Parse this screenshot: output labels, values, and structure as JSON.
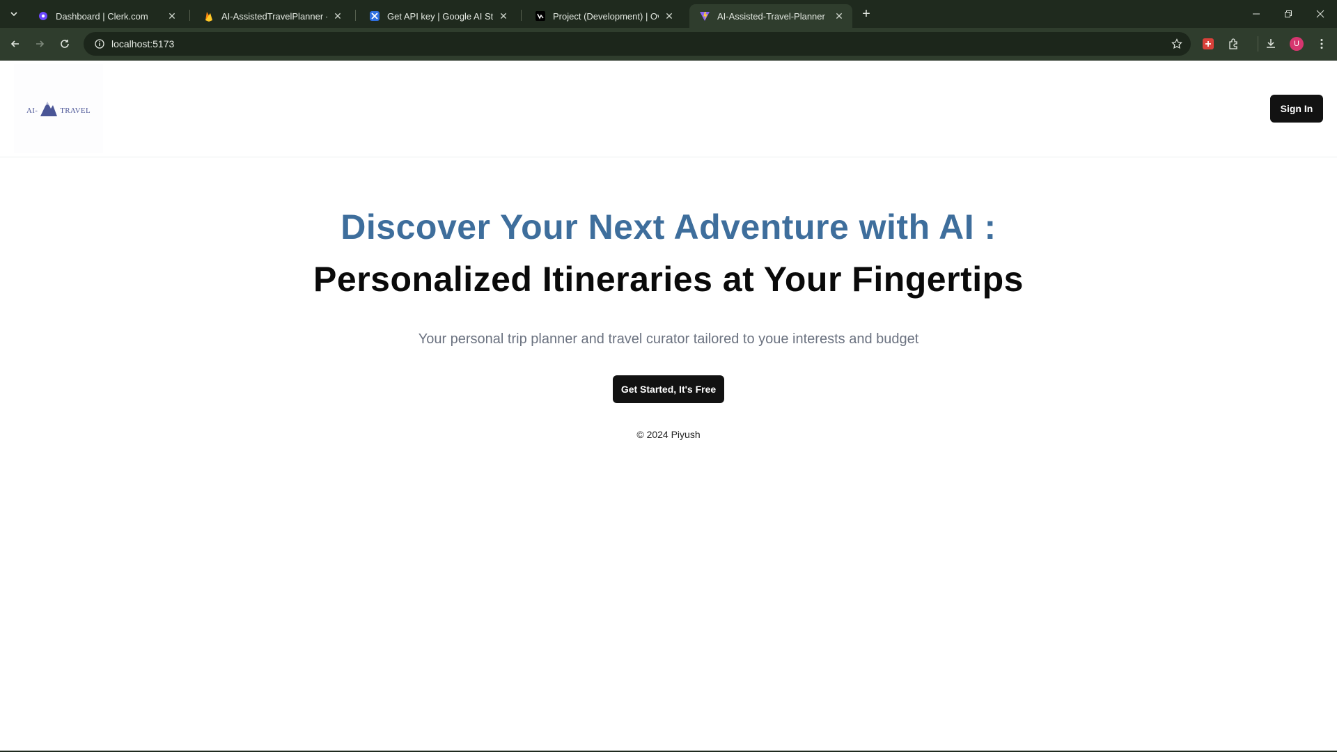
{
  "browser": {
    "tabs": [
      {
        "title": "Dashboard | Clerk.com",
        "favicon": "clerk-icon"
      },
      {
        "title": "AI-AssistedTravelPlanner - Clou",
        "favicon": "firebase-icon"
      },
      {
        "title": "Get API key | Google AI Studio",
        "favicon": "ai-studio-icon"
      },
      {
        "title": "Project (Development) | Overvi",
        "favicon": "vercel-icon"
      },
      {
        "title": "AI-Assisted-Travel-Planner",
        "favicon": "vite-icon"
      }
    ],
    "address": "localhost:5173",
    "profile_initial": "U"
  },
  "header": {
    "logo_text_left": "AI-",
    "logo_text_right": "TRAVEL",
    "signin_label": "Sign In"
  },
  "hero": {
    "title_line1": "Discover Your Next Adventure with AI :",
    "title_line2": "Personalized Itineraries at Your Fingertips",
    "subtitle": "Your personal trip planner and travel curator tailored to youe interests and budget",
    "cta_label": "Get Started, It's Free"
  },
  "footer": {
    "text": "© 2024 Piyush"
  },
  "colors": {
    "accent_blue": "#3e6e9c",
    "button_dark": "#121212",
    "chrome_dark": "#1f2a1e",
    "chrome_toolbar": "#2f3d2d"
  }
}
